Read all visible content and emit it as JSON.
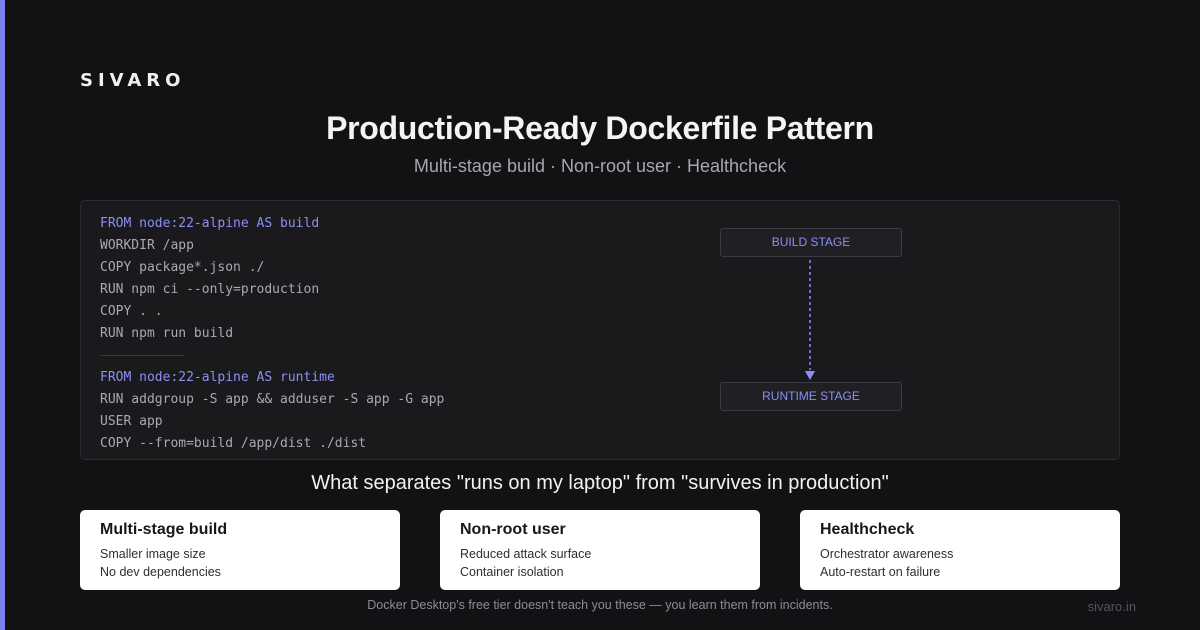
{
  "brand": "SIVARO",
  "title": "Production-Ready Dockerfile Pattern",
  "subtitle": "Multi-stage build · Non-root user · Healthcheck",
  "code": {
    "build_lines": [
      "FROM node:22-alpine AS build",
      "WORKDIR /app",
      "COPY package*.json ./",
      "RUN npm ci --only=production",
      "COPY . .",
      "RUN npm run build"
    ],
    "runtime_lines": [
      "FROM node:22-alpine AS runtime",
      "RUN addgroup -S app && adduser -S app -G app",
      "USER app",
      "COPY --from=build /app/dist ./dist"
    ]
  },
  "diagram": {
    "build_stage_label": "BUILD STAGE",
    "runtime_stage_label": "RUNTIME STAGE"
  },
  "tagline": "What separates \"runs on my laptop\" from \"survives in production\"",
  "cards": [
    {
      "title": "Multi-stage build",
      "lines": [
        "Smaller image size",
        "No dev dependencies"
      ]
    },
    {
      "title": "Non-root user",
      "lines": [
        "Reduced attack surface",
        "Container isolation"
      ]
    },
    {
      "title": "Healthcheck",
      "lines": [
        "Orchestrator awareness",
        "Auto-restart on failure"
      ]
    }
  ],
  "footer": "Docker Desktop's free tier doesn't teach you these — you learn them from incidents.",
  "site": "sivaro.in",
  "colors": {
    "accent": "#7b82f2",
    "background": "#121214",
    "code_keyword": "#8b8ff5",
    "card_background": "#ffffff"
  }
}
